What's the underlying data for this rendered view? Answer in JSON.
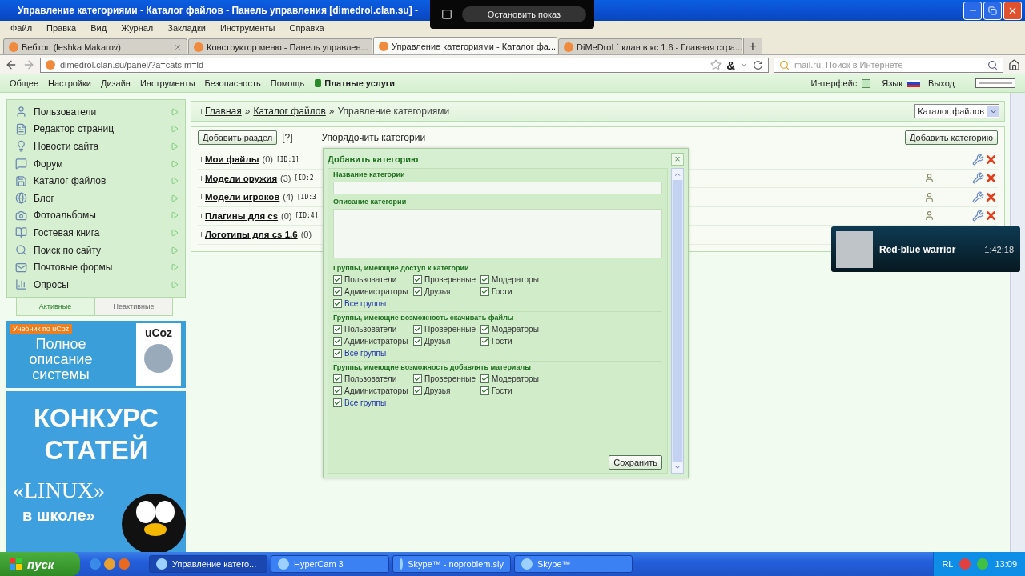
{
  "window": {
    "title": "Управление категориями - Каталог файлов - Панель управления [dimedrol.clan.su] -"
  },
  "menu": [
    "Файл",
    "Правка",
    "Вид",
    "Журнал",
    "Закладки",
    "Инструменты",
    "Справка"
  ],
  "tabs": [
    {
      "label": "Вебтоп (leshka Makarov)",
      "selected": false
    },
    {
      "label": "Конструктор меню - Панель управлен...",
      "selected": false
    },
    {
      "label": "Управление категориями - Каталог фа...",
      "selected": true
    },
    {
      "label": "DiMeDroL` клан в кс 1.6 - Главная стра...",
      "selected": false
    }
  ],
  "new_tab": "+",
  "address": {
    "url": "dimedrol.clan.su/panel/?a=cats;m=ld",
    "glyph": "&"
  },
  "search": {
    "placeholder": "mail.ru: Поиск в Интернете"
  },
  "admin_menu": {
    "items": [
      "Общее",
      "Настройки",
      "Дизайн",
      "Инструменты",
      "Безопасность",
      "Помощь"
    ],
    "paid": "Платные услуги",
    "interface": "Интерфейс",
    "language": "Язык",
    "logout": "Выход"
  },
  "sidebar": {
    "items": [
      "Пользователи",
      "Редактор страниц",
      "Новости сайта",
      "Форум",
      "Каталог файлов",
      "Блог",
      "Фотоальбомы",
      "Гостевая книга",
      "Поиск по сайту",
      "Почтовые формы",
      "Опросы"
    ],
    "tabs": [
      {
        "label": "Активные",
        "selected": true
      },
      {
        "label": "Неактивные",
        "selected": false
      }
    ]
  },
  "banners": [
    {
      "kind": "ucoz",
      "badge": "Учебник по uCoz",
      "title": "Полное описание системы",
      "logo": "uCoz"
    },
    {
      "kind": "linux",
      "title": "КОНКУРС СТАТЕЙ",
      "logo": "«LINUX»",
      "footer": "в школе»"
    }
  ],
  "breadcrumb": {
    "links": [
      "Главная",
      "Каталог файлов"
    ],
    "current": "Управление категориями",
    "separator": "»"
  },
  "section_select": "Каталог файлов",
  "toolbar": {
    "add_section": "Добавить раздел",
    "help": "[?]",
    "order": "Упорядочить категории",
    "add_category": "Добавить категорию"
  },
  "categories": [
    {
      "name": "Мои файлы",
      "count": "(0)",
      "id": "[ID:1]",
      "user_icon": false,
      "actions": true
    },
    {
      "name": "Модели оружия",
      "count": "(3)",
      "id": "[ID:2",
      "user_icon": true,
      "actions": true
    },
    {
      "name": "Модели игроков",
      "count": "(4)",
      "id": "[ID:3",
      "user_icon": true,
      "actions": true
    },
    {
      "name": "Плагины для cs",
      "count": "(0)",
      "id": "[ID:4]",
      "user_icon": true,
      "actions": true
    },
    {
      "name": "Логотипы для cs 1.6",
      "count": "(0)"
    }
  ],
  "dialog": {
    "title": "Добавить категорию",
    "close": "×",
    "name_label": "Название категории",
    "description_label": "Описание категории",
    "groups": [
      {
        "legend": "Группы, имеющие доступ к категории",
        "options": [
          {
            "label": "Пользователи",
            "kind": "group",
            "checked": true
          },
          {
            "label": "Проверенные",
            "kind": "group",
            "checked": true
          },
          {
            "label": "Модераторы",
            "kind": "group",
            "checked": true
          },
          {
            "label": "Администраторы",
            "kind": "group",
            "checked": true
          },
          {
            "label": "Друзья",
            "kind": "group",
            "checked": true
          },
          {
            "label": "Гости",
            "kind": "group",
            "checked": true
          },
          {
            "label": "Все группы",
            "kind": "all",
            "checked": true
          }
        ]
      },
      {
        "legend": "Группы, имеющие возможность скачивать файлы",
        "options": [
          {
            "label": "Пользователи",
            "kind": "group",
            "checked": true
          },
          {
            "label": "Проверенные",
            "kind": "group",
            "checked": true
          },
          {
            "label": "Модераторы",
            "kind": "group",
            "checked": true
          },
          {
            "label": "Администраторы",
            "kind": "group",
            "checked": true
          },
          {
            "label": "Друзья",
            "kind": "group",
            "checked": true
          },
          {
            "label": "Гости",
            "kind": "group",
            "checked": true
          },
          {
            "label": "Все группы",
            "kind": "all",
            "checked": true
          }
        ]
      },
      {
        "legend": "Группы, имеющие возможность добавлять материалы",
        "options": [
          {
            "label": "Пользователи",
            "kind": "group",
            "checked": true
          },
          {
            "label": "Проверенные",
            "kind": "group",
            "checked": true
          },
          {
            "label": "Модераторы",
            "kind": "group",
            "checked": true
          },
          {
            "label": "Администраторы",
            "kind": "group",
            "checked": true
          },
          {
            "label": "Друзья",
            "kind": "group",
            "checked": true
          },
          {
            "label": "Гости",
            "kind": "group",
            "checked": true
          },
          {
            "label": "Все группы",
            "kind": "all",
            "checked": true
          }
        ]
      }
    ],
    "save": "Сохранить"
  },
  "notification": {
    "title": "Red-blue warrior",
    "time": "1:42:18"
  },
  "share_bar": {
    "button": "Остановить показ"
  },
  "taskbar": {
    "start": "пуск",
    "tasks": [
      {
        "label": "Управление катего...",
        "selected": true
      },
      {
        "label": "HyperCam 3",
        "selected": false
      },
      {
        "label": "Skype™ - noproblem.sly",
        "selected": false
      },
      {
        "label": "Skype™",
        "selected": false
      }
    ],
    "tray_label": "RL",
    "clock": "13:09"
  }
}
